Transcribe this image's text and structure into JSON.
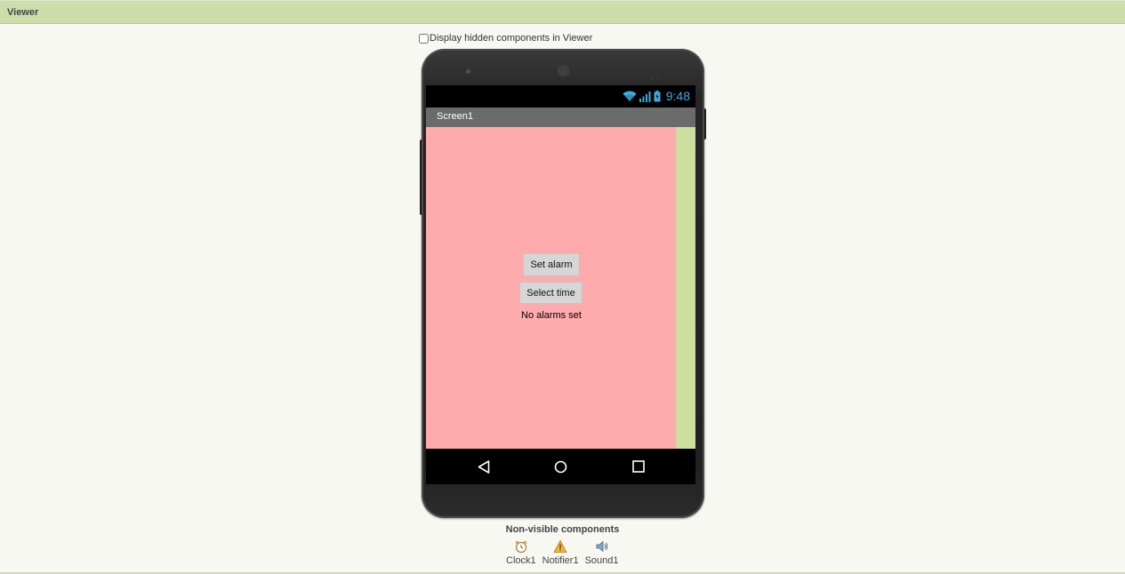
{
  "viewer": {
    "title": "Viewer",
    "hidden_toggle_label": "Display hidden components in Viewer",
    "hidden_toggle_checked": false
  },
  "phone": {
    "status_time": "9:48",
    "screen_title": "Screen1",
    "screen_bg_color": "#ffaaad",
    "screen_edge_color": "#cddea0",
    "buttons": {
      "set_alarm": "Set alarm",
      "select_time": "Select time"
    },
    "alarm_status": "No alarms set",
    "nav_icons": [
      "back-triangle-icon",
      "home-circle-icon",
      "recent-square-icon"
    ],
    "status_icons": [
      "wifi-icon",
      "signal-icon",
      "battery-icon"
    ]
  },
  "non_visible": {
    "title": "Non-visible components",
    "components": [
      {
        "label": "Clock1",
        "icon": "clock-icon"
      },
      {
        "label": "Notifier1",
        "icon": "warning-icon"
      },
      {
        "label": "Sound1",
        "icon": "speaker-icon"
      }
    ]
  },
  "colors": {
    "header_bg": "#cddeaa",
    "accent_time": "#3aaee0"
  }
}
